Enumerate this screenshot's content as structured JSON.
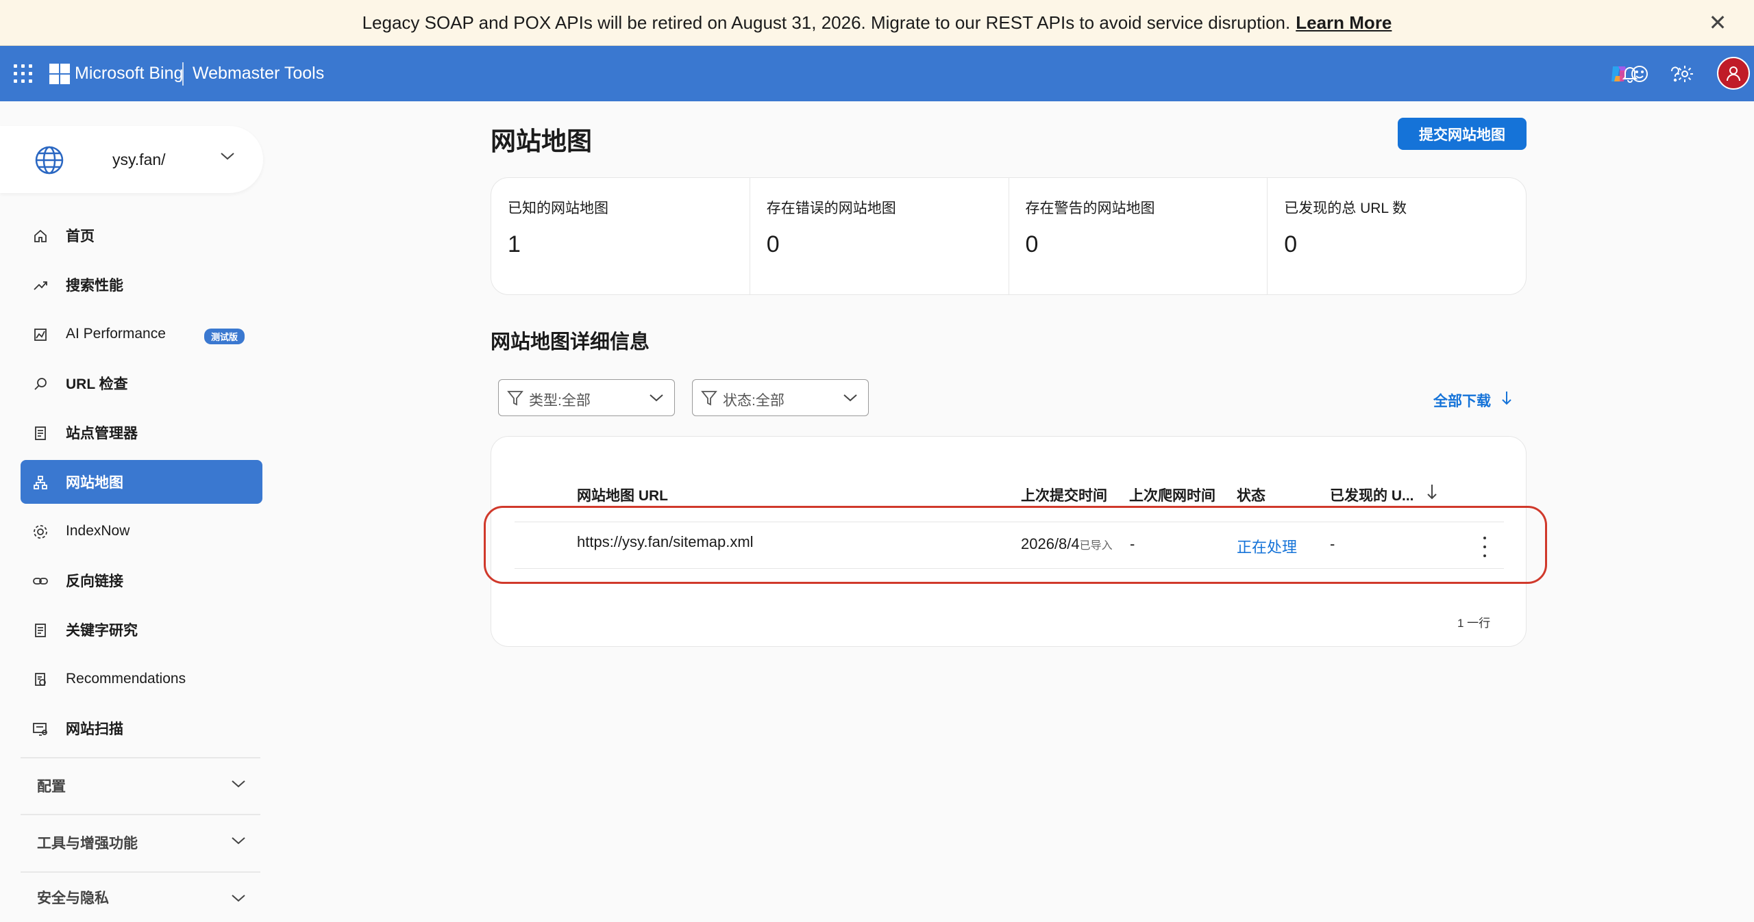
{
  "banner": {
    "text": "Legacy SOAP and POX APIs will be retired on August 31, 2026. Migrate to our REST APIs to avoid service disruption.",
    "link": "Learn More",
    "close_icon": "close-icon"
  },
  "header": {
    "brand": "Microsoft Bing",
    "product": "Webmaster Tools",
    "icons": [
      "waffle-icon",
      "copilot-icon",
      "bell-icon",
      "help-icon",
      "feedback-icon",
      "settings-icon",
      "user-avatar-icon"
    ],
    "accent": "#3a78d0"
  },
  "sidebar": {
    "site": "ysy.fan/",
    "items": [
      {
        "label": "首页",
        "icon": "home-icon"
      },
      {
        "label": "搜索性能",
        "icon": "trend-icon"
      },
      {
        "label": "AI Performance",
        "icon": "chart-icon",
        "badge": "测试版"
      },
      {
        "label": "URL 检查",
        "icon": "search-icon"
      },
      {
        "label": "站点管理器",
        "icon": "document-icon"
      },
      {
        "label": "网站地图",
        "icon": "sitemap-icon",
        "active": true
      },
      {
        "label": "IndexNow",
        "icon": "gear-icon"
      },
      {
        "label": "反向链接",
        "icon": "link-icon"
      },
      {
        "label": "关键字研究",
        "icon": "document-icon"
      },
      {
        "label": "Recommendations",
        "icon": "recommendation-icon"
      },
      {
        "label": "网站扫描",
        "icon": "scan-icon"
      }
    ],
    "sections": [
      "配置",
      "工具与增强功能",
      "安全与隐私"
    ]
  },
  "main": {
    "title": "网站地图",
    "submit_button": "提交网站地图",
    "stats": [
      {
        "label": "已知的网站地图",
        "value": "1"
      },
      {
        "label": "存在错误的网站地图",
        "value": "0"
      },
      {
        "label": "存在警告的网站地图",
        "value": "0"
      },
      {
        "label": "已发现的总 URL 数",
        "value": "0"
      }
    ],
    "details_title": "网站地图详细信息",
    "filters": [
      {
        "label": "类型:全部"
      },
      {
        "label": "状态:全部"
      }
    ],
    "download": "全部下载",
    "table": {
      "headers": [
        "网站地图 URL",
        "上次提交时间",
        "上次爬网时间",
        "状态",
        "已发现的 U..."
      ],
      "rows": [
        {
          "url": "https://ysy.fan/sitemap.xml",
          "submitted": "2026/8/4",
          "submitted_suffix": "已导入",
          "crawled": "-",
          "status": "正在处理",
          "discovered": "-"
        }
      ],
      "row_count": "1 一行"
    },
    "highlight_color": "#d0392b"
  }
}
